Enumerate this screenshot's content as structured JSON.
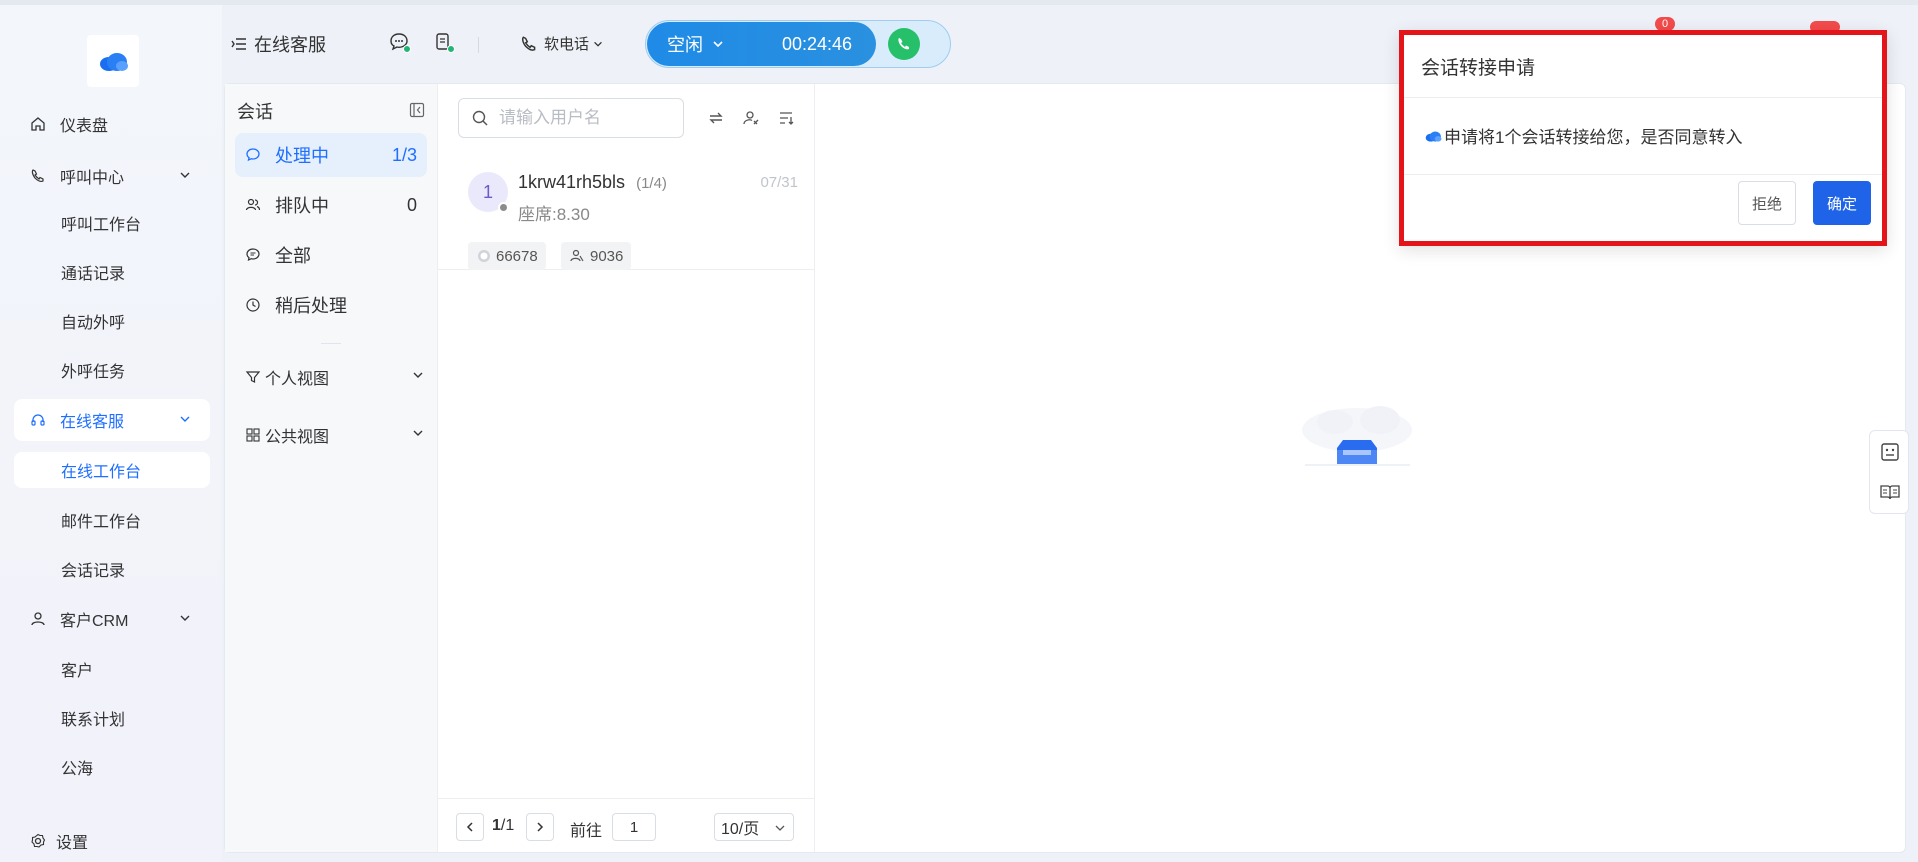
{
  "sidebar": {
    "items": [
      {
        "label": "仪表盘"
      },
      {
        "label": "呼叫中心"
      },
      {
        "label": "呼叫工作台"
      },
      {
        "label": "通话记录"
      },
      {
        "label": "自动外呼"
      },
      {
        "label": "外呼任务"
      },
      {
        "label": "在线客服"
      },
      {
        "label": "在线工作台"
      },
      {
        "label": "邮件工作台"
      },
      {
        "label": "会话记录"
      },
      {
        "label": "客户CRM"
      },
      {
        "label": "客户"
      },
      {
        "label": "联系计划"
      },
      {
        "label": "公海"
      }
    ],
    "settings_label": "设置"
  },
  "header": {
    "title": "在线客服",
    "softphone_label": "软电话",
    "status_label": "空闲",
    "timer": "00:24:46",
    "badge_count": "0"
  },
  "conversations": {
    "heading": "会话",
    "filters": [
      {
        "label": "处理中",
        "count": "1/3"
      },
      {
        "label": "排队中",
        "count": "0"
      },
      {
        "label": "全部",
        "count": ""
      },
      {
        "label": "稍后处理",
        "count": ""
      }
    ],
    "views": [
      {
        "label": "个人视图"
      },
      {
        "label": "公共视图"
      }
    ]
  },
  "session_list": {
    "search_placeholder": "请输入用户名",
    "sessions": [
      {
        "avatar_text": "1",
        "name": "1krw41rh5bls",
        "fraction": "(1/4)",
        "subtitle": "座席:8.30",
        "date": "07/31",
        "tags": [
          "66678",
          "9036"
        ]
      }
    ],
    "pager": {
      "current": "1",
      "separator": "/",
      "total": "1",
      "goto_label": "前往",
      "goto_value": "1",
      "page_size": "10/页"
    }
  },
  "dialog": {
    "title": "会话转接申请",
    "message": "申请将1个会话转接给您，是否同意转入",
    "reject_label": "拒绝",
    "confirm_label": "确定"
  },
  "colors": {
    "accent": "#1f6fff",
    "status_blue": "#1f8be6",
    "call_green": "#26c06a",
    "dialog_highlight": "#e3141a"
  }
}
